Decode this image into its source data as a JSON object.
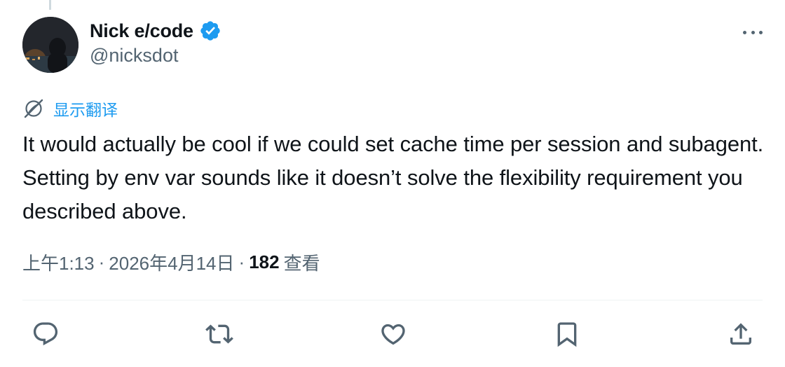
{
  "tweet": {
    "author_name": "Nick e/code",
    "author_handle": "@nicksdot",
    "translate_label": "显示翻译",
    "text": "It would actually be cool if we could set cache time per session and subagent. Setting by env var sounds like it doesn’t solve the flexibility requirement you described above.",
    "time": "上午1:13",
    "separator": "·",
    "date": "2026年4月14日",
    "views_count": "182",
    "views_label": "查看",
    "accent_color": "#1d9bf0"
  },
  "icons": {
    "verified": "verified-badge-icon",
    "more": "more-horizontal-icon",
    "translate": "translate-globe-icon",
    "reply": "reply-icon",
    "retweet": "retweet-icon",
    "like": "heart-icon",
    "bookmark": "bookmark-icon",
    "share": "share-icon"
  }
}
